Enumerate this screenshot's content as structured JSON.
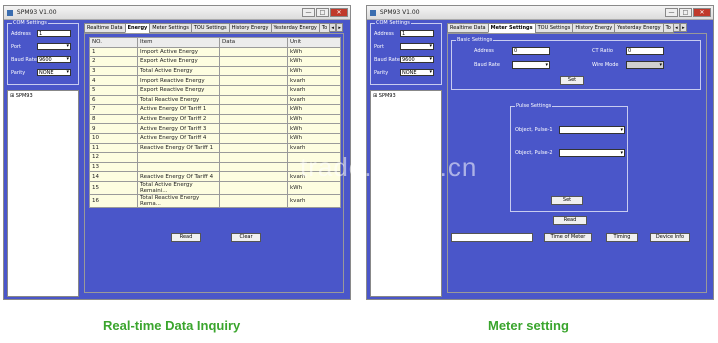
{
  "left": {
    "title": "SPM93 V1.00",
    "com": {
      "legend": "COM Settings",
      "address_label": "Address",
      "address_value": "1",
      "port_label": "Port",
      "port_value": "",
      "baud_label": "Baud Rate",
      "baud_value": "9600",
      "parity_label": "Parity",
      "parity_value": "NONE"
    },
    "tree_item": "SPM93",
    "tabs": [
      "Realtime Data",
      "Energy",
      "Meter Settings",
      "TOU Settings",
      "History Energy",
      "Yesterday Energy",
      "To"
    ],
    "active_tab": "Energy",
    "table": {
      "headers": [
        "NO.",
        "Item",
        "Data",
        "Unit"
      ],
      "rows": [
        [
          "1",
          "Import Active Energy",
          "",
          "kWh"
        ],
        [
          "2",
          "Export Active Energy",
          "",
          "kWh"
        ],
        [
          "3",
          "Total Active Energy",
          "",
          "kWh"
        ],
        [
          "4",
          "Import Reactive Energy",
          "",
          "kvarh"
        ],
        [
          "5",
          "Export Reactive Energy",
          "",
          "kvarh"
        ],
        [
          "6",
          "Total Reactive Energy",
          "",
          "kvarh"
        ],
        [
          "7",
          "Active Energy Of Tariff 1",
          "",
          "kWh"
        ],
        [
          "8",
          "Active Energy Of Tariff 2",
          "",
          "kWh"
        ],
        [
          "9",
          "Active Energy Of Tariff 3",
          "",
          "kWh"
        ],
        [
          "10",
          "Active Energy Of Tariff 4",
          "",
          "kWh"
        ],
        [
          "11",
          "Reactive Energy Of Tariff 1",
          "",
          "kvarh"
        ],
        [
          "12",
          "",
          "",
          ""
        ],
        [
          "13",
          "",
          "",
          ""
        ],
        [
          "14",
          "Reactive Energy Of Tariff 4",
          "",
          "kvarh"
        ],
        [
          "15",
          "Total Active Energy Remaini...",
          "",
          "kWh"
        ],
        [
          "16",
          "Total Reactive Energy Rema...",
          "",
          "kvarh"
        ]
      ]
    },
    "read_label": "Read",
    "clear_label": "Clear"
  },
  "right": {
    "title": "SPM93 V1.00",
    "com": {
      "legend": "COM Settings",
      "address_label": "Address",
      "address_value": "1",
      "port_label": "Port",
      "port_value": "",
      "baud_label": "Baud Rate",
      "baud_value": "9600",
      "parity_label": "Parity",
      "parity_value": "NONE"
    },
    "tree_item": "SPM93",
    "tabs": [
      "Realtime Data",
      "Meter Settings",
      "TOU Settings",
      "History Energy",
      "Yesterday Energy",
      "To"
    ],
    "active_tab": "Meter Settings",
    "basic": {
      "legend": "Basic Settings",
      "address_label": "Address",
      "address_value": "0",
      "ct_label": "CT Ratio",
      "ct_value": "0",
      "baud_label": "Baud Rate",
      "baud_value": "",
      "wire_label": "Wire Mode",
      "wire_value": "",
      "set_label": "Set"
    },
    "pulse": {
      "legend": "Pulse Settings",
      "pulse1_label": "Object, Pulse-1",
      "pulse1_value": "",
      "pulse2_label": "Object, Pulse-2",
      "pulse2_value": "",
      "set_label": "Set"
    },
    "read_label": "Read",
    "time_label": "Time of Meter",
    "timing_label": "Timing",
    "device_info_label": "Device Info"
  },
  "captions": {
    "left": "Real-time Data Inquiry",
    "right": "Meter setting"
  },
  "watermark": "trade.china.cn",
  "colors": {
    "panel_bg": "#4a56c9",
    "table_cell": "#fdfde0",
    "caption": "#3aa52d"
  }
}
